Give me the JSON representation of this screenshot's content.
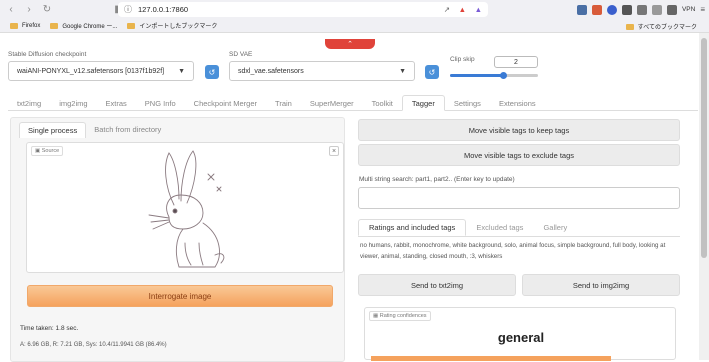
{
  "browser": {
    "url": "127.0.0.1:7860",
    "vpn_label": "VPN"
  },
  "bookmarks": {
    "items": [
      "Firefox",
      "Google Chrome ー...",
      "インポートしたブックマーク"
    ],
    "right": "すべてのブックマーク"
  },
  "settings": {
    "checkpoint_label": "Stable Diffusion checkpoint",
    "checkpoint_value": "waiANI-PONYXL_v12.safetensors [0137f1b92f]",
    "vae_label": "SD VAE",
    "vae_value": "sdxl_vae.safetensors",
    "clip_label": "Clip skip",
    "clip_value": "2",
    "clip_fraction": 0.6
  },
  "tabs": [
    "txt2img",
    "img2img",
    "Extras",
    "PNG Info",
    "Checkpoint Merger",
    "Train",
    "SuperMerger",
    "Toolkit",
    "Tagger",
    "Settings",
    "Extensions"
  ],
  "left": {
    "subtabs": [
      "Single process",
      "Batch from directory"
    ],
    "source_label": "Source",
    "interrogate_label": "Interrogate image",
    "time_taken": "Time taken: 1.8 sec.",
    "memory": "A: 6.96 GB, R: 7.21 GB, Sys: 10.4/11.9941 GB (86.4%)"
  },
  "right": {
    "keep_label": "Move visible tags to keep tags",
    "exclude_label": "Move visible tags to exclude tags",
    "multi_label": "Multi string search: part1, part2.. (Enter key to update)",
    "tabs": [
      "Ratings and included tags",
      "Excluded tags",
      "Gallery"
    ],
    "tags": "no humans, rabbit, monochrome, white background, solo, animal focus, simple background, full body, looking at viewer, animal, standing, closed mouth, :3, whiskers",
    "send_txt2img": "Send to txt2img",
    "send_img2img": "Send to img2img",
    "conf_label": "Rating confidences",
    "conf_top": "general"
  },
  "colors": {
    "accent": "#f5a25d",
    "red": "#e0433a",
    "blue": "#3a7bd5"
  }
}
